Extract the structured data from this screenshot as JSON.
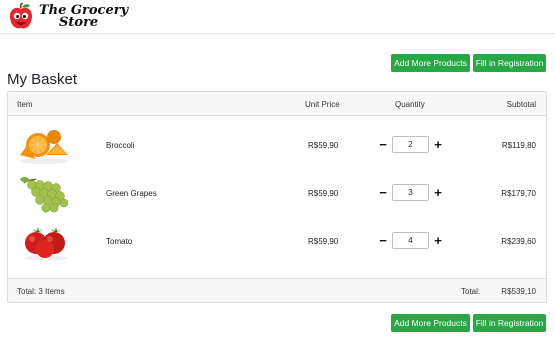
{
  "brand": {
    "line1": "The Grocery",
    "line2": "Store"
  },
  "actions": {
    "add_more": "Add More Products",
    "fill_registration": "Fill in Registration"
  },
  "page": {
    "title": "My Basket"
  },
  "table": {
    "headers": {
      "item": "Item",
      "unit_price": "Unit Price",
      "quantity": "Quantity",
      "subtotal": "Subtotal"
    },
    "rows": [
      {
        "name": "Broccoli",
        "image": "orange-image",
        "unit_price": "R$59,90",
        "quantity": "2",
        "subtotal": "R$119,80"
      },
      {
        "name": "Green Grapes",
        "image": "grapes-image",
        "unit_price": "R$59,90",
        "quantity": "3",
        "subtotal": "R$179,70"
      },
      {
        "name": "Tomato",
        "image": "tomato-image",
        "unit_price": "R$59,90",
        "quantity": "4",
        "subtotal": "R$239,60"
      }
    ],
    "minus_symbol": "−",
    "plus_symbol": "+",
    "footer": {
      "total_items": "Total: 3 Items",
      "total_label": "Total:",
      "total_value": "R$539,10"
    }
  },
  "colors": {
    "primary_button": "#28a745",
    "header_bg": "#f7f7f7",
    "border": "#dcdcdc"
  }
}
